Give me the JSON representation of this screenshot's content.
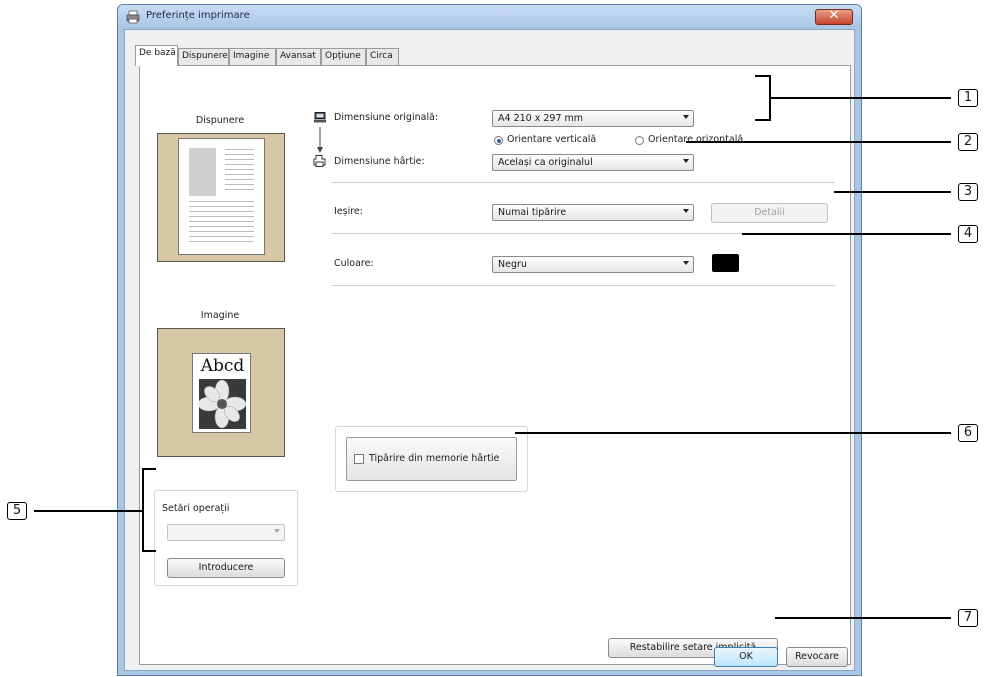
{
  "window": {
    "title": "Preferințe imprimare",
    "close_label": "✕"
  },
  "tabs": [
    {
      "label": "De bază",
      "active": true
    },
    {
      "label": "Dispunere",
      "active": false
    },
    {
      "label": "Imagine",
      "active": false
    },
    {
      "label": "Avansat",
      "active": false
    },
    {
      "label": "Opțiune",
      "active": false
    },
    {
      "label": "Circa",
      "active": false
    }
  ],
  "previews": {
    "layout_caption": "Dispunere",
    "image_caption": "Imagine",
    "image_sample_text": "Abcd"
  },
  "form": {
    "original_size_label": "Dimensiune originală:",
    "original_size_value": "A4 210 x 297 mm",
    "orientation_portrait": "Orientare verticală",
    "orientation_landscape": "Orientare orizontală",
    "orientation_selected": "portrait",
    "paper_size_label": "Dimensiune hârtie:",
    "paper_size_value": "Același ca originalul",
    "output_label": "Ieșire:",
    "output_value": "Numai tipărire",
    "details_button": "Detalii",
    "color_label": "Culoare:",
    "color_value": "Negru",
    "color_swatch": "#000000"
  },
  "operations": {
    "title": "Setări operații",
    "select_value": "",
    "enter_button": "Introducere"
  },
  "paper_memory": {
    "label": "Tipărire din memorie hârtie",
    "checked": false
  },
  "restore_button": "Restabilire setare implicită",
  "footer": {
    "ok_button": "OK",
    "cancel_button": "Revocare"
  },
  "callouts": [
    "1",
    "2",
    "3",
    "4",
    "5",
    "6",
    "7"
  ]
}
